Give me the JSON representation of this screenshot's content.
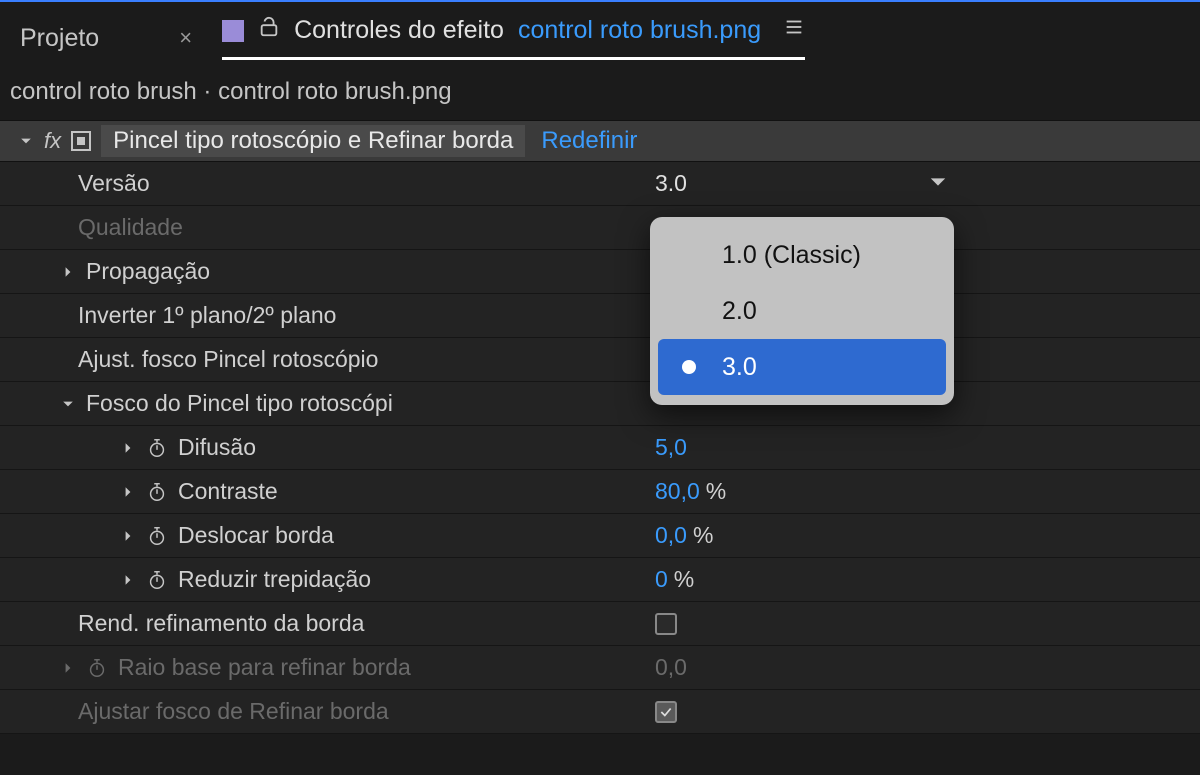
{
  "tabs": {
    "project": "Projeto",
    "active_label": "Controles do efeito",
    "active_file": "control roto brush.png"
  },
  "breadcrumb": "control roto brush · control roto brush.png",
  "effect": {
    "fx": "fx",
    "name": "Pincel tipo rotoscópio e Refinar borda",
    "reset": "Redefinir"
  },
  "props": {
    "version": {
      "label": "Versão",
      "value": "3.0"
    },
    "quality": {
      "label": "Qualidade"
    },
    "propagation": {
      "label": "Propagação"
    },
    "invert": {
      "label": "Inverter 1º plano/2º plano"
    },
    "adjust_matte": {
      "label": "Ajust. fosco Pincel rotoscópio"
    },
    "matte_group": {
      "label": "Fosco do Pincel tipo rotoscópi"
    },
    "feather": {
      "label": "Difusão",
      "value": "5,0"
    },
    "contrast": {
      "label": "Contraste",
      "value": "80,0",
      "suffix": "%"
    },
    "shift_edge": {
      "label": "Deslocar borda",
      "value": "0,0",
      "suffix": "%"
    },
    "reduce_chatter": {
      "label": "Reduzir trepidação",
      "value": "0",
      "suffix": "%"
    },
    "render_refine": {
      "label": "Rend. refinamento da borda"
    },
    "base_radius": {
      "label": "Raio base para refinar borda",
      "value": "0,0"
    },
    "adjust_refine": {
      "label": "Ajustar fosco de Refinar borda"
    }
  },
  "dropdown": {
    "options": [
      "1.0 (Classic)",
      "2.0",
      "3.0"
    ],
    "selected_index": 2
  }
}
